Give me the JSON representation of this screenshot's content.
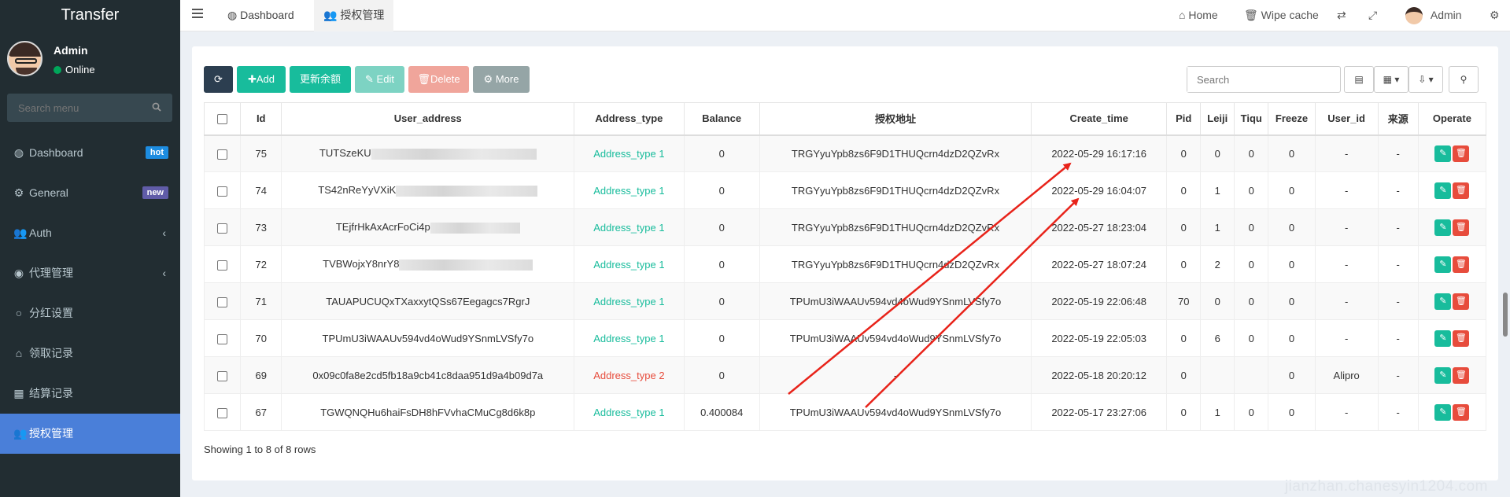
{
  "app": {
    "title": "Transfer"
  },
  "user": {
    "name": "Admin",
    "status": "Online"
  },
  "sidebar": {
    "search_placeholder": "Search menu",
    "items": [
      {
        "label": "Dashboard",
        "badge": "hot"
      },
      {
        "label": "General",
        "badge": "new"
      },
      {
        "label": "Auth"
      },
      {
        "label": "代理管理"
      },
      {
        "label": "分红设置"
      },
      {
        "label": "领取记录"
      },
      {
        "label": "结算记录"
      },
      {
        "label": "授权管理"
      }
    ]
  },
  "topbar": {
    "tabs": [
      "Dashboard",
      "授权管理"
    ],
    "home": "Home",
    "wipe_cache": "Wipe cache",
    "admin": "Admin"
  },
  "toolbar": {
    "add": "Add",
    "balance": "更新余额",
    "edit": "Edit",
    "delete": "Delete",
    "more": "More",
    "search_placeholder": "Search"
  },
  "table": {
    "columns": [
      "Id",
      "User_address",
      "Address_type",
      "Balance",
      "授权地址",
      "Create_time",
      "Pid",
      "Leiji",
      "Tiqu",
      "Freeze",
      "User_id",
      "来源",
      "Operate"
    ],
    "rows": [
      {
        "id": "75",
        "user_address": "TUTSzeKU",
        "address_type": "Address_type 1",
        "balance": "0",
        "auth_address": "TRGYyuYpb8zs6F9D1THUQcrn4dzD2QZvRx",
        "create_time": "2022-05-29 16:17:16",
        "pid": "0",
        "leiji": "0",
        "tiqu": "0",
        "freeze": "0",
        "user_id": "-",
        "source": "-"
      },
      {
        "id": "74",
        "user_address": "TS42nReYyVXiK",
        "address_type": "Address_type 1",
        "balance": "0",
        "auth_address": "TRGYyuYpb8zs6F9D1THUQcrn4dzD2QZvRx",
        "create_time": "2022-05-29 16:04:07",
        "pid": "0",
        "leiji": "1",
        "tiqu": "0",
        "freeze": "0",
        "user_id": "-",
        "source": "-"
      },
      {
        "id": "73",
        "user_address": "TEjfrHkAxAcrFoCi4p",
        "address_type": "Address_type 1",
        "balance": "0",
        "auth_address": "TRGYyuYpb8zs6F9D1THUQcrn4dzD2QZvRx",
        "create_time": "2022-05-27 18:23:04",
        "pid": "0",
        "leiji": "1",
        "tiqu": "0",
        "freeze": "0",
        "user_id": "-",
        "source": "-"
      },
      {
        "id": "72",
        "user_address": "TVBWojxY8nrY8",
        "address_type": "Address_type 1",
        "balance": "0",
        "auth_address": "TRGYyuYpb8zs6F9D1THUQcrn4dzD2QZvRx",
        "create_time": "2022-05-27 18:07:24",
        "pid": "0",
        "leiji": "2",
        "tiqu": "0",
        "freeze": "0",
        "user_id": "-",
        "source": "-"
      },
      {
        "id": "71",
        "user_address": "TAUAPUCUQxTXaxxytQSs67Eegagcs7RgrJ",
        "address_type": "Address_type 1",
        "balance": "0",
        "auth_address": "TPUmU3iWAAUv594vd4oWud9YSnmLVSfy7o",
        "create_time": "2022-05-19 22:06:48",
        "pid": "70",
        "leiji": "0",
        "tiqu": "0",
        "freeze": "0",
        "user_id": "-",
        "source": "-"
      },
      {
        "id": "70",
        "user_address": "TPUmU3iWAAUv594vd4oWud9YSnmLVSfy7o",
        "address_type": "Address_type 1",
        "balance": "0",
        "auth_address": "TPUmU3iWAAUv594vd4oWud9YSnmLVSfy7o",
        "create_time": "2022-05-19 22:05:03",
        "pid": "0",
        "leiji": "6",
        "tiqu": "0",
        "freeze": "0",
        "user_id": "-",
        "source": "-"
      },
      {
        "id": "69",
        "user_address": "0x09c0fa8e2cd5fb18a9cb41c8daa951d9a4b09d7a",
        "address_type": "Address_type 2",
        "balance": "0",
        "auth_address": "-",
        "create_time": "2022-05-18 20:20:12",
        "pid": "0",
        "leiji": "",
        "tiqu": "",
        "freeze": "0",
        "user_id": "Alipro",
        "source": "-"
      },
      {
        "id": "67",
        "user_address": "TGWQNQHu6haiFsDH8hFVvhaCMuCg8d6k8p",
        "address_type": "Address_type 1",
        "balance": "0.400084",
        "auth_address": "TPUmU3iWAAUv594vd4oWud9YSnmLVSfy7o",
        "create_time": "2022-05-17 23:27:06",
        "pid": "0",
        "leiji": "1",
        "tiqu": "0",
        "freeze": "0",
        "user_id": "-",
        "source": "-"
      }
    ]
  },
  "footer": {
    "info": "Showing 1 to 8 of 8 rows"
  },
  "watermark": "jianzhan.chanesyin1204.com",
  "colors": {
    "sidebar": "#222d32",
    "active_menu": "#4a7fd9",
    "success": "#18bc9c",
    "danger": "#e74c3c",
    "arrow": "#e8231a"
  }
}
